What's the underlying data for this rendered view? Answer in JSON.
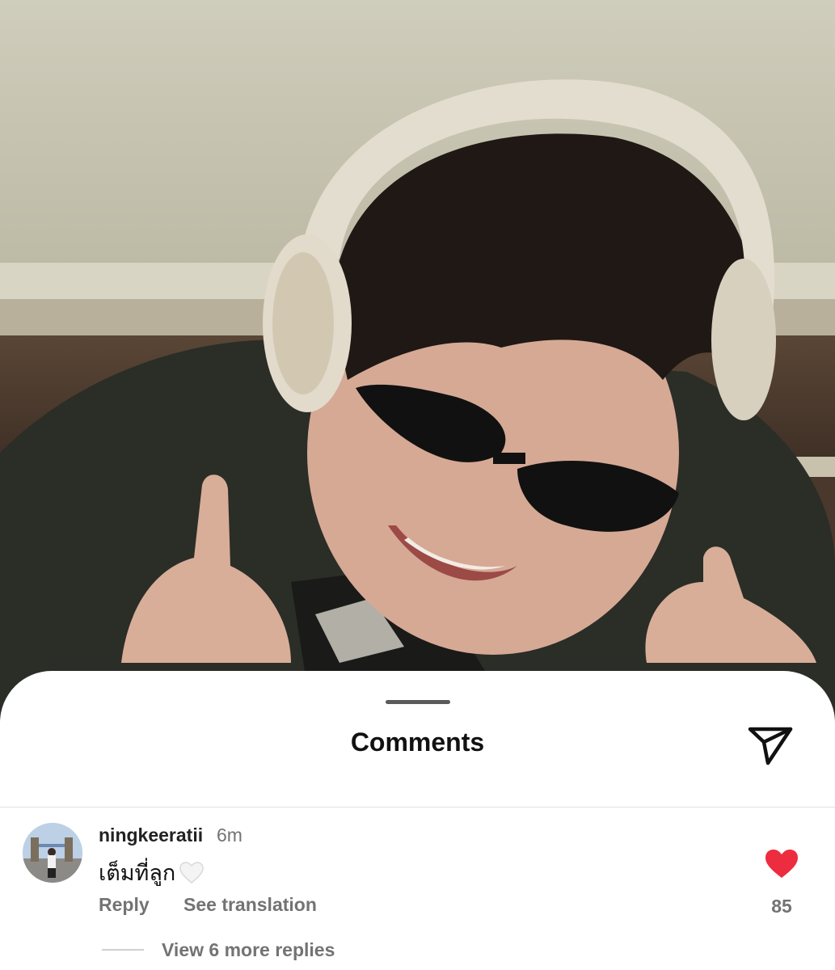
{
  "sheet": {
    "title": "Comments",
    "share_icon": "paper-plane-icon"
  },
  "comment": {
    "username": "ningkeeratii",
    "time": "6m",
    "text": "เต็มที่ลูก",
    "emoji": "white-heart",
    "reply_label": "Reply",
    "translate_label": "See translation",
    "like_icon": "heart-filled-icon",
    "like_color": "#ed2c3f",
    "like_count": "85",
    "view_replies_label": "View 6 more replies"
  }
}
